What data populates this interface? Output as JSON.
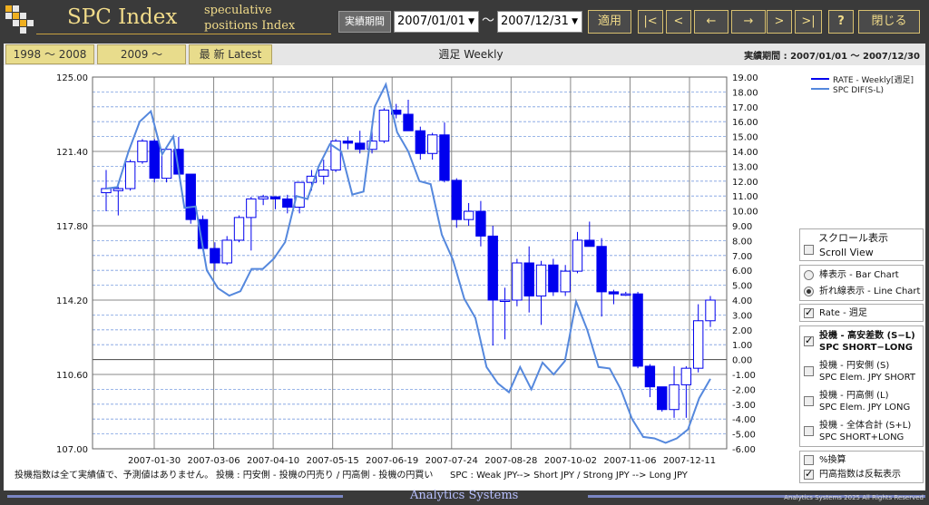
{
  "header": {
    "title": "SPC Index",
    "subtitle_line1": "speculative",
    "subtitle_line2": "positions Index",
    "period_label": "実績期間",
    "start_date": "2007/01/01",
    "end_date": "2007/12/31",
    "range_sep": "～",
    "apply": "適用",
    "nav_first": "|<",
    "nav_prev": "<",
    "nav_back": "←",
    "nav_fwd": "→",
    "nav_next": ">",
    "nav_last": ">|",
    "help": "?",
    "close": "閉じる"
  },
  "tabs": {
    "t1": "1998 ～ 2008",
    "t2": "2009 ～",
    "t3": "最 新  Latest",
    "weekly": "週足 Weekly",
    "range_info": "実績期間 : 2007/01/01 ～ 2007/12/30"
  },
  "chart_data": {
    "type": "candlestick+line",
    "y_left": {
      "ticks": [
        "125.00",
        "121.40",
        "117.80",
        "114.20",
        "110.60",
        "107.00"
      ],
      "range": [
        107.0,
        125.0
      ]
    },
    "y_right": {
      "ticks": [
        "19.00",
        "18.00",
        "17.00",
        "16.00",
        "15.00",
        "14.00",
        "13.00",
        "12.00",
        "11.00",
        "10.00",
        "9.00",
        "8.00",
        "7.00",
        "6.00",
        "5.00",
        "4.00",
        "3.00",
        "2.00",
        "1.00",
        "0.00",
        "-1.00",
        "-2.00",
        "-3.00",
        "-4.00",
        "-5.00",
        "-6.00"
      ],
      "range": [
        -6.0,
        19.0
      ]
    },
    "x_labels": [
      "2007-01-30",
      "2007-03-06",
      "2007-04-10",
      "2007-05-15",
      "2007-06-19",
      "2007-07-24",
      "2007-08-28",
      "2007-10-02",
      "2007-11-06",
      "2007-12-11"
    ],
    "legend": [
      "RATE - Weekly[週足]",
      "SPC DIF(S-L)"
    ],
    "candles": [
      {
        "o": 119.4,
        "h": 120.5,
        "l": 118.5,
        "c": 119.6
      },
      {
        "o": 119.5,
        "h": 119.7,
        "l": 118.3,
        "c": 119.6
      },
      {
        "o": 119.6,
        "h": 121.0,
        "l": 119.5,
        "c": 120.9
      },
      {
        "o": 120.9,
        "h": 122.0,
        "l": 120.8,
        "c": 121.9
      },
      {
        "o": 121.9,
        "h": 122.0,
        "l": 119.9,
        "c": 120.1
      },
      {
        "o": 120.1,
        "h": 121.6,
        "l": 119.9,
        "c": 121.5
      },
      {
        "o": 121.5,
        "h": 122.1,
        "l": 120.3,
        "c": 120.3
      },
      {
        "o": 120.3,
        "h": 120.3,
        "l": 117.9,
        "c": 118.1
      },
      {
        "o": 118.1,
        "h": 118.3,
        "l": 116.6,
        "c": 116.7
      },
      {
        "o": 116.7,
        "h": 117.0,
        "l": 115.6,
        "c": 116.0
      },
      {
        "o": 116.0,
        "h": 117.3,
        "l": 115.9,
        "c": 117.1
      },
      {
        "o": 117.1,
        "h": 118.3,
        "l": 117.0,
        "c": 118.2
      },
      {
        "o": 118.2,
        "h": 119.2,
        "l": 116.6,
        "c": 119.1
      },
      {
        "o": 119.1,
        "h": 119.3,
        "l": 118.8,
        "c": 119.2
      },
      {
        "o": 119.2,
        "h": 119.2,
        "l": 118.6,
        "c": 119.1
      },
      {
        "o": 119.1,
        "h": 119.3,
        "l": 118.4,
        "c": 118.7
      },
      {
        "o": 118.7,
        "h": 119.9,
        "l": 118.4,
        "c": 119.9
      },
      {
        "o": 119.9,
        "h": 120.5,
        "l": 119.5,
        "c": 120.2
      },
      {
        "o": 120.2,
        "h": 121.0,
        "l": 119.8,
        "c": 120.5
      },
      {
        "o": 120.5,
        "h": 122.0,
        "l": 120.4,
        "c": 121.9
      },
      {
        "o": 121.9,
        "h": 122.1,
        "l": 121.5,
        "c": 121.8
      },
      {
        "o": 121.8,
        "h": 122.4,
        "l": 121.3,
        "c": 121.5
      },
      {
        "o": 121.5,
        "h": 122.5,
        "l": 121.3,
        "c": 121.9
      },
      {
        "o": 121.9,
        "h": 123.5,
        "l": 121.8,
        "c": 123.4
      },
      {
        "o": 123.4,
        "h": 123.7,
        "l": 123.0,
        "c": 123.2
      },
      {
        "o": 123.2,
        "h": 123.9,
        "l": 122.4,
        "c": 122.4
      },
      {
        "o": 122.4,
        "h": 122.6,
        "l": 121.0,
        "c": 121.3
      },
      {
        "o": 121.3,
        "h": 122.3,
        "l": 121.0,
        "c": 122.2
      },
      {
        "o": 122.2,
        "h": 122.8,
        "l": 119.9,
        "c": 120.0
      },
      {
        "o": 120.0,
        "h": 120.1,
        "l": 117.7,
        "c": 118.1
      },
      {
        "o": 118.1,
        "h": 118.9,
        "l": 117.8,
        "c": 118.5
      },
      {
        "o": 118.5,
        "h": 119.0,
        "l": 116.8,
        "c": 117.3
      },
      {
        "o": 117.3,
        "h": 117.8,
        "l": 112.0,
        "c": 114.2
      },
      {
        "o": 114.2,
        "h": 114.8,
        "l": 112.3,
        "c": 114.2
      },
      {
        "o": 114.2,
        "h": 116.2,
        "l": 113.9,
        "c": 116.0
      },
      {
        "o": 116.0,
        "h": 116.8,
        "l": 113.6,
        "c": 114.4
      },
      {
        "o": 114.4,
        "h": 116.1,
        "l": 113.0,
        "c": 115.9
      },
      {
        "o": 115.9,
        "h": 116.2,
        "l": 114.4,
        "c": 114.6
      },
      {
        "o": 114.6,
        "h": 115.9,
        "l": 114.4,
        "c": 115.6
      },
      {
        "o": 115.6,
        "h": 117.5,
        "l": 115.5,
        "c": 117.1
      },
      {
        "o": 117.1,
        "h": 118.0,
        "l": 116.8,
        "c": 116.8
      },
      {
        "o": 116.8,
        "h": 117.2,
        "l": 113.4,
        "c": 114.6
      },
      {
        "o": 114.6,
        "h": 114.7,
        "l": 114.0,
        "c": 114.5
      },
      {
        "o": 114.5,
        "h": 114.6,
        "l": 114.4,
        "c": 114.5
      },
      {
        "o": 114.5,
        "h": 114.6,
        "l": 110.9,
        "c": 111.0
      },
      {
        "o": 111.0,
        "h": 111.1,
        "l": 109.5,
        "c": 110.0
      },
      {
        "o": 110.0,
        "h": 110.0,
        "l": 108.8,
        "c": 108.9
      },
      {
        "o": 108.9,
        "h": 111.0,
        "l": 108.5,
        "c": 110.1
      },
      {
        "o": 110.1,
        "h": 111.0,
        "l": 108.5,
        "c": 110.9
      },
      {
        "o": 110.9,
        "h": 114.0,
        "l": 110.7,
        "c": 113.2
      },
      {
        "o": 113.2,
        "h": 114.4,
        "l": 112.9,
        "c": 114.2
      }
    ],
    "spc_dif": [
      11.5,
      11.6,
      14.0,
      16.0,
      16.7,
      13.8,
      15.0,
      10.2,
      10.3,
      6.0,
      4.8,
      4.3,
      4.6,
      6.1,
      6.1,
      6.8,
      7.9,
      11.0,
      10.8,
      13.0,
      14.5,
      14.0,
      11.1,
      11.3,
      17.0,
      18.5,
      15.3,
      14.0,
      12.0,
      11.8,
      8.4,
      6.7,
      4.1,
      2.8,
      -0.5,
      -1.6,
      -2.2,
      -0.5,
      -2.0,
      -0.2,
      -1.0,
      -0.1,
      3.9,
      2.0,
      -0.5,
      -0.6,
      -2.0,
      -4.0,
      -5.2,
      -5.3,
      -5.6,
      -5.3,
      -4.7,
      -2.6,
      -1.3
    ]
  },
  "panel": {
    "scroll_ja": "スクロール表示",
    "scroll_en": "Scroll View",
    "bar_chart": "棒表示 - Bar Chart",
    "line_chart": "折れ線表示 - Line Chart",
    "rate": "Rate - 週足",
    "spc_ja": "投機 - 高安差数 (S−L)",
    "spc_en": "SPC  SHORT−LONG",
    "jpy_short_ja": "投機 - 円安側 (S)",
    "jpy_short_en": "SPC Elem. JPY SHORT",
    "jpy_long_ja": "投機 - 円高側 (L)",
    "jpy_long_en": "SPC Elem. JPY LONG",
    "total_ja": "投機 - 全体合計 (S+L)",
    "total_en": "SPC  SHORT+LONG",
    "pct": "%換算",
    "invert": "円高指数は反転表示"
  },
  "notes": {
    "left": "投機指数は全て実績値で、予測値はありません。",
    "middle": "投機 : 円安側 - 投機の円売り / 円高側 - 投機の円買い",
    "right": "SPC : Weak JPY--> Short JPY / Strong JPY --> Long JPY"
  },
  "footer": {
    "center": "Analytics Systems",
    "copyright": "Analytics Systems 2025 All Rights Reserved"
  },
  "colors": {
    "candle": "#0000ee",
    "spc_line": "#5588dd",
    "brand": "#f2dc8a"
  }
}
